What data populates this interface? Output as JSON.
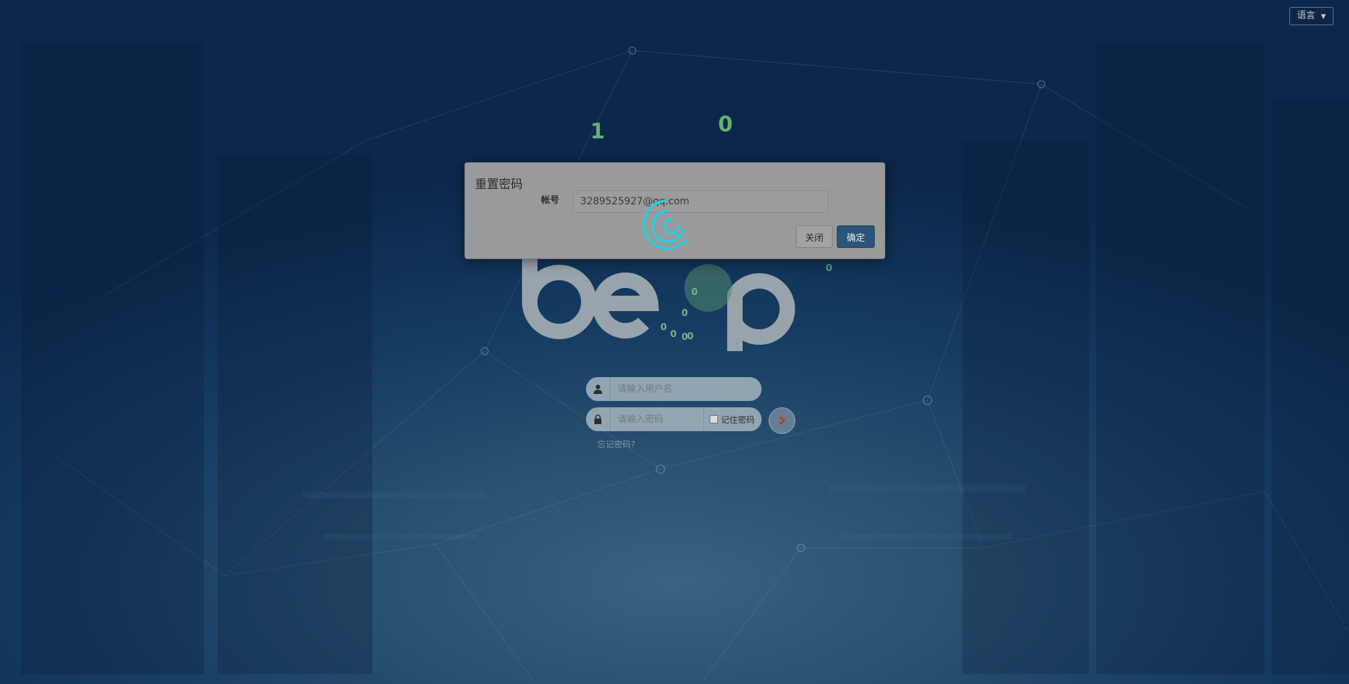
{
  "header": {
    "language_label": "语言"
  },
  "decor_digits": {
    "left_digit": "1",
    "right_digit": "0",
    "small_zero": "0"
  },
  "login": {
    "username_placeholder": "请输入用户名",
    "password_placeholder": "请输入密码",
    "remember_label": "记住密码",
    "forgot_label": "忘记密码?"
  },
  "modal": {
    "title": "重置密码",
    "account_label": "帐号",
    "account_value": "3289525927@qq.com",
    "close_label": "关闭",
    "confirm_label": "确定"
  },
  "icons": {
    "user": "user-icon",
    "lock": "lock-icon",
    "arrow": "chevron-right-icon",
    "spinner": "loading-spinner-icon"
  },
  "colors": {
    "confirm_button": "#2b5578",
    "spinner": "#19d4e8",
    "login_arrow": "#c0442a",
    "digits": "#6fbf7c"
  }
}
